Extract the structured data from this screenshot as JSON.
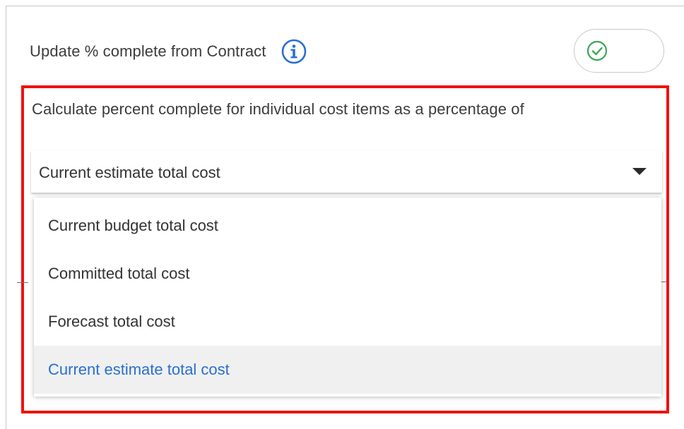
{
  "header": {
    "label": "Update % complete from Contract",
    "info_icon": "info-circle-icon",
    "toggle_icon": "check-circle-icon",
    "toggle_on": true
  },
  "section": {
    "question": "Calculate percent complete for individual cost items as a percentage of",
    "select": {
      "selected_value": "Current estimate total cost",
      "caret_icon": "caret-down-icon"
    },
    "options": [
      {
        "label": "Current budget total cost",
        "selected": false
      },
      {
        "label": "Committed total cost",
        "selected": false
      },
      {
        "label": "Forecast total cost",
        "selected": false
      },
      {
        "label": "Current estimate total cost",
        "selected": true
      }
    ]
  },
  "colors": {
    "highlight_border": "#ee1111",
    "info_blue": "#2a6fd1",
    "toggle_green": "#3aa757",
    "selected_text": "#2a6fd1",
    "selected_bg": "#f0f0f0"
  }
}
